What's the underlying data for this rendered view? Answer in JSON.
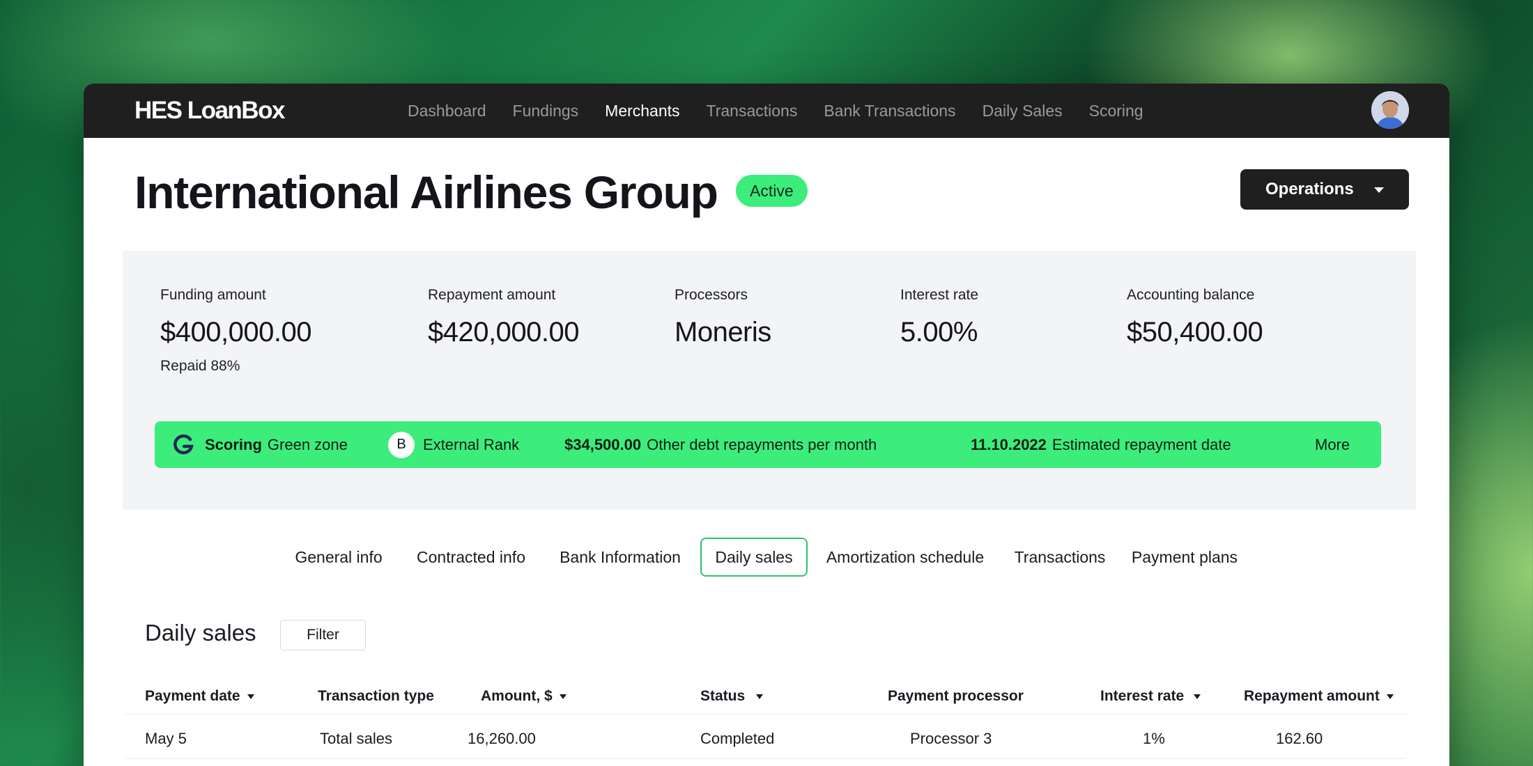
{
  "app": {
    "logo": "HES LoanBox"
  },
  "nav": {
    "items": [
      {
        "label": "Dashboard"
      },
      {
        "label": "Fundings"
      },
      {
        "label": "Merchants"
      },
      {
        "label": "Transactions"
      },
      {
        "label": "Bank Transactions"
      },
      {
        "label": "Daily Sales"
      },
      {
        "label": "Scoring"
      }
    ],
    "active": "Merchants"
  },
  "merchant": {
    "name": "International Airlines Group",
    "status": "Active",
    "operations_label": "Operations"
  },
  "summary": {
    "metrics": [
      {
        "label": "Funding amount",
        "value": "$400,000.00",
        "sub": "Repaid 88%"
      },
      {
        "label": "Repayment amount",
        "value": "$420,000.00"
      },
      {
        "label": "Processors",
        "value": "Moneris"
      },
      {
        "label": "Interest rate",
        "value": "5.00%"
      },
      {
        "label": "Accounting balance",
        "value": "$50,400.00"
      }
    ],
    "scoring": {
      "label": "Scoring",
      "zone": "Green zone",
      "rank_letter": "B",
      "rank_label": "External Rank",
      "debt_value": "$34,500.00",
      "debt_label": "Other debt repayments per month",
      "date_value": "11.10.2022",
      "date_label": "Estimated repayment date",
      "more": "More"
    }
  },
  "tabs": {
    "items": [
      {
        "label": "General info"
      },
      {
        "label": "Contracted info"
      },
      {
        "label": "Bank Information"
      },
      {
        "label": "Daily sales"
      },
      {
        "label": "Amortization schedule"
      },
      {
        "label": "Transactions"
      },
      {
        "label": "Payment plans"
      }
    ],
    "active": "Daily sales"
  },
  "daily_sales": {
    "title": "Daily sales",
    "filter_label": "Filter",
    "columns": [
      "Payment date",
      "Transaction type",
      "Amount, $",
      "Status",
      "Payment processor",
      "Interest rate",
      "Repayment amount"
    ],
    "rows": [
      [
        "May 5",
        "Total sales",
        "16,260.00",
        "Completed",
        "Processor 3",
        "1%",
        "162.60"
      ]
    ]
  },
  "colors": {
    "accent_green": "#3ded7c",
    "topbar": "#1f1f1f",
    "tab_border": "#2ec46b"
  }
}
